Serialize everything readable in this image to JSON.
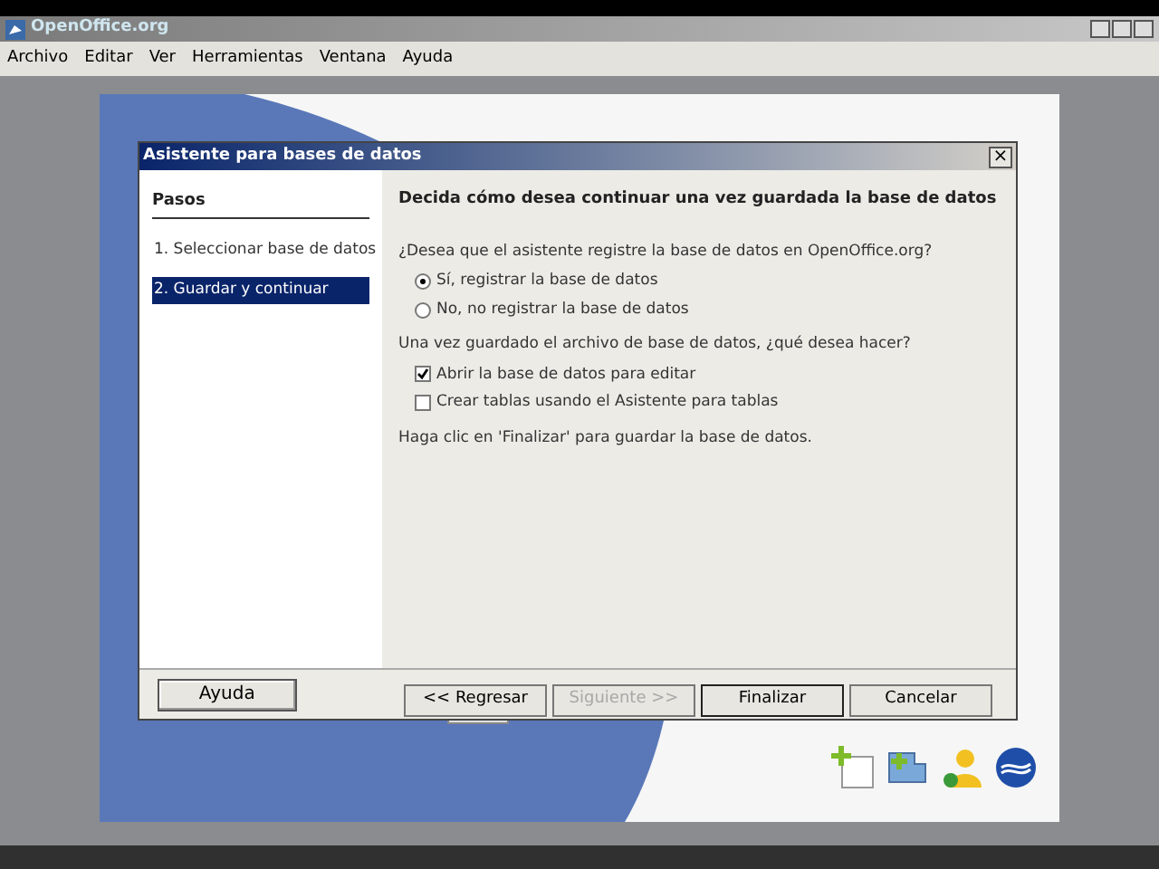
{
  "window": {
    "title": "OpenOffice.org"
  },
  "menu": [
    "Archivo",
    "Editar",
    "Ver",
    "Herramientas",
    "Ventana",
    "Ayuda"
  ],
  "dialog": {
    "title": "Asistente para bases de datos",
    "close": "×",
    "steps_title": "Pasos",
    "steps": [
      {
        "label": "1. Seleccionar base de datos",
        "selected": false
      },
      {
        "label": "2. Guardar y continuar",
        "selected": true
      }
    ],
    "heading": "Decida cómo desea continuar una vez guardada la base de datos",
    "question1": "¿Desea que el asistente registre la base de datos en OpenOffice.org?",
    "radios": [
      {
        "label": "Sí, registrar la base de datos",
        "selected": true
      },
      {
        "label": "No, no registrar la base de datos",
        "selected": false
      }
    ],
    "question2": "Una vez guardado el archivo de base de datos, ¿qué desea hacer?",
    "checkboxes": [
      {
        "label": "Abrir la base de datos para editar",
        "checked": true
      },
      {
        "label": "Crear tablas usando el Asistente para tablas",
        "checked": false
      }
    ],
    "note": "Haga clic en 'Finalizar' para guardar la base de datos.",
    "help_button": {
      "label": "Ayuda",
      "disabled": false
    },
    "buttons": [
      {
        "label": "<< Regresar",
        "disabled": false
      },
      {
        "label": "Siguiente >>",
        "disabled": true
      },
      {
        "label": "Finalizar",
        "disabled": false
      },
      {
        "label": "Cancelar",
        "disabled": false
      }
    ]
  }
}
